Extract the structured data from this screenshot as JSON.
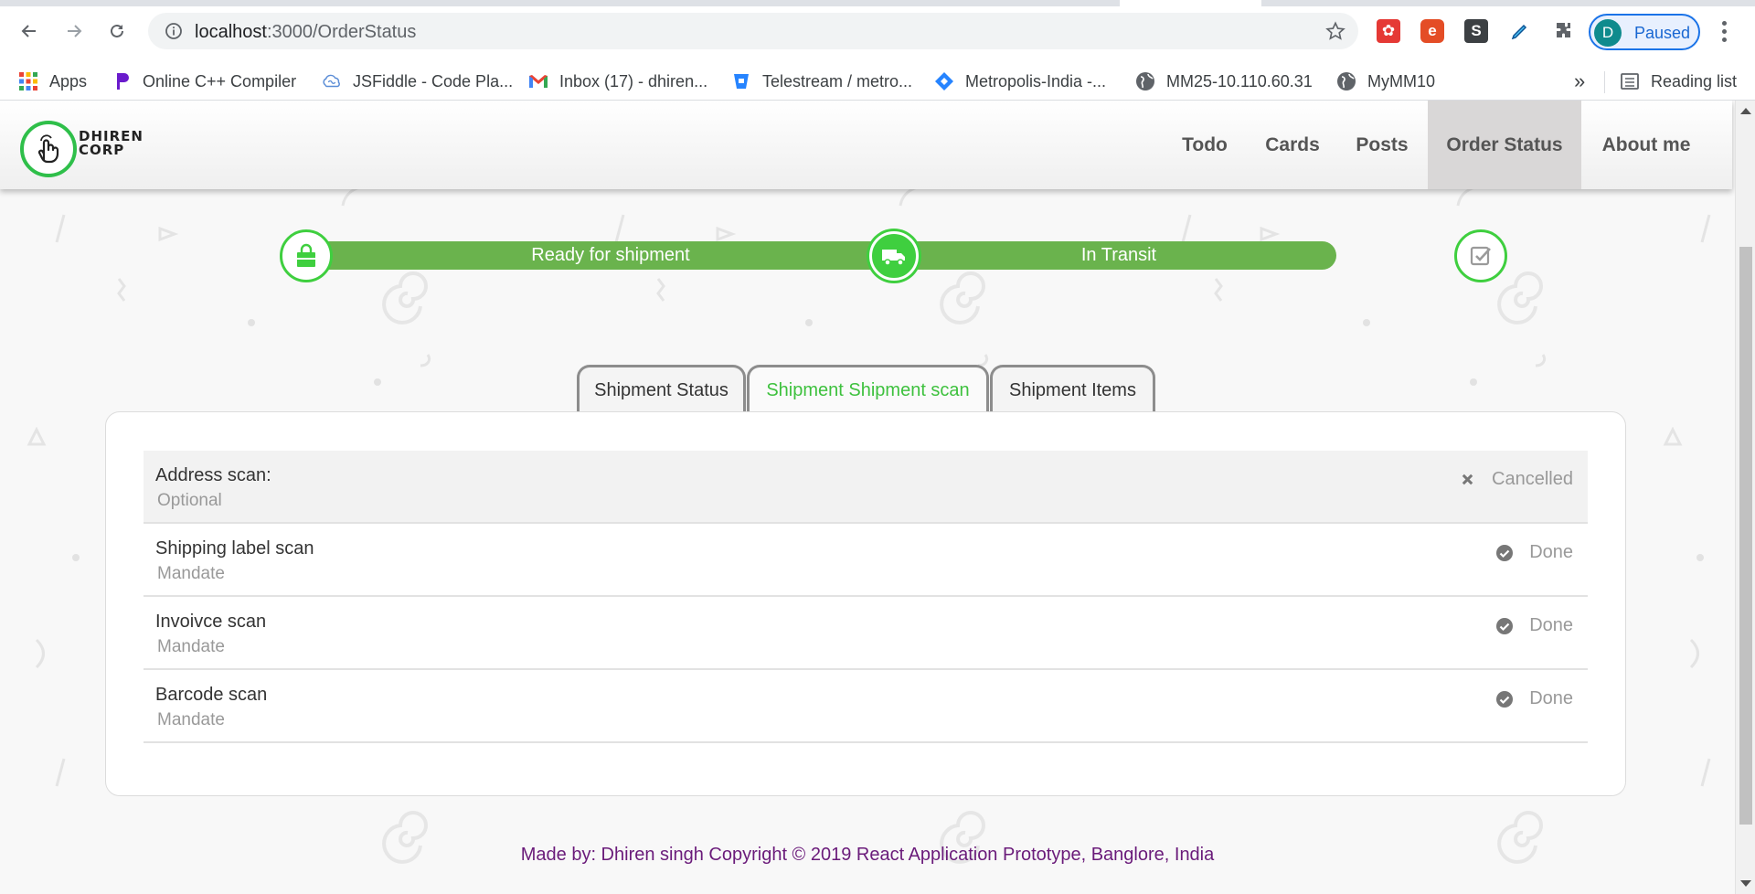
{
  "browser": {
    "url_host": "localhost",
    "url_path": ":3000/OrderStatus",
    "profile_initial": "D",
    "profile_status": "Paused",
    "bookmarks": [
      {
        "label": "Apps",
        "icon": "apps-grid-icon"
      },
      {
        "label": "Online C++ Compiler",
        "icon": "compiler-icon"
      },
      {
        "label": "JSFiddle - Code Pla...",
        "icon": "jsfiddle-icon"
      },
      {
        "label": "Inbox (17) - dhiren...",
        "icon": "gmail-icon"
      },
      {
        "label": "Telestream / metro...",
        "icon": "bitbucket-icon"
      },
      {
        "label": "Metropolis-India -...",
        "icon": "jira-icon"
      },
      {
        "label": "MM25-10.110.60.31",
        "icon": "globe-icon"
      },
      {
        "label": "MyMM10",
        "icon": "globe-icon"
      }
    ],
    "more_bookmarks": "»",
    "reading_list": "Reading list"
  },
  "app": {
    "logo_line1": "DHIREN",
    "logo_line2": "CORP",
    "menu": [
      "Todo",
      "Cards",
      "Posts",
      "Order Status",
      "About me"
    ],
    "active_menu": "Order Status"
  },
  "progress": {
    "steps": [
      {
        "label": "Ready for shipment",
        "icon": "shopping-bag-icon"
      },
      {
        "label": "In Transit",
        "icon": "truck-icon"
      },
      {
        "label": "",
        "icon": "check-square-icon"
      }
    ]
  },
  "tabs": {
    "items": [
      "Shipment Status",
      "Shipment Shipment scan",
      "Shipment Items"
    ],
    "active": "Shipment Shipment scan"
  },
  "scans": [
    {
      "name": "Address scan:",
      "requirement": "Optional",
      "status": "Cancelled",
      "status_icon": "x-icon"
    },
    {
      "name": "Shipping label scan",
      "requirement": "Mandate",
      "status": "Done",
      "status_icon": "check-circle-icon"
    },
    {
      "name": "Invoivce scan",
      "requirement": "Mandate",
      "status": "Done",
      "status_icon": "check-circle-icon"
    },
    {
      "name": "Barcode scan",
      "requirement": "Mandate",
      "status": "Done",
      "status_icon": "check-circle-icon"
    }
  ],
  "footer": {
    "line1": "Made by: Dhiren singh Copyright © 2019 React Application Prototype, Banglore, India"
  },
  "colors": {
    "accent_green": "#3ec13e",
    "track_green": "#6ab34d",
    "footer_purple": "#6a1b7a",
    "active_menu_bg": "#d9d7d7"
  }
}
